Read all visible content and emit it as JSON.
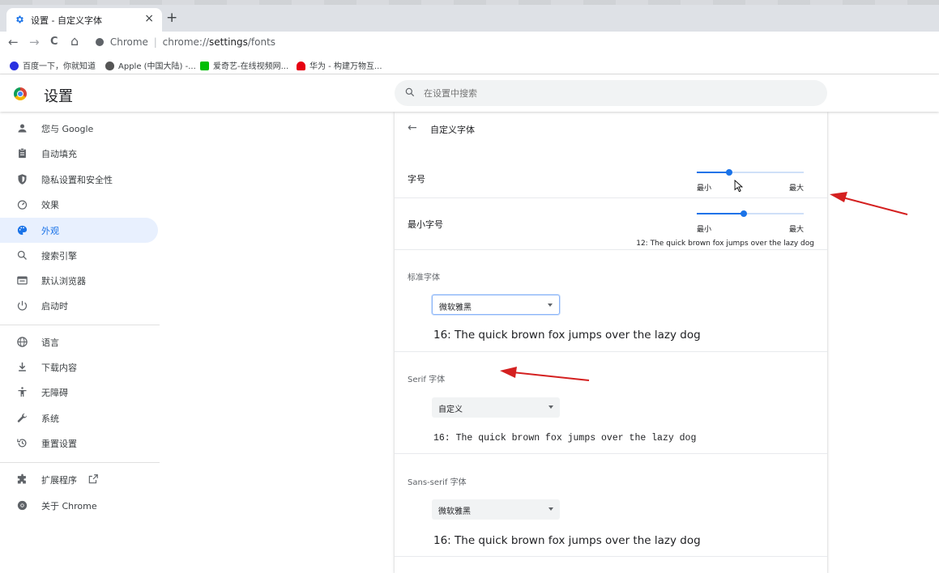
{
  "tab": {
    "title": "设置 - 自定义字体",
    "close_glyph": "×",
    "new_tab_glyph": "+"
  },
  "toolbar": {
    "back_glyph": "←",
    "forward_glyph": "→",
    "reload_glyph": "C",
    "home_glyph": "⌂",
    "site_label": "Chrome",
    "separator": "|",
    "url_scheme": "chrome://",
    "url_host": "settings",
    "url_path": "/fonts"
  },
  "bookmarks": [
    {
      "label": "百度一下，你就知道",
      "color": "#2932e1"
    },
    {
      "label": "Apple (中国大陆) -...",
      "color": "#555555"
    },
    {
      "label": "爱奇艺-在线视频网...",
      "color": "#00be06"
    },
    {
      "label": "华为 - 构建万物互...",
      "color": "#e60012"
    }
  ],
  "header": {
    "title": "设置",
    "search_placeholder": "在设置中搜索"
  },
  "sidebar": {
    "items": [
      {
        "label": "您与 Google",
        "icon": "person-icon",
        "active": false
      },
      {
        "label": "自动填充",
        "icon": "clipboard-icon",
        "active": false
      },
      {
        "label": "隐私设置和安全性",
        "icon": "shield-icon",
        "active": false
      },
      {
        "label": "效果",
        "icon": "speedometer-icon",
        "active": false
      },
      {
        "label": "外观",
        "icon": "palette-icon",
        "active": true
      },
      {
        "label": "搜索引擎",
        "icon": "search-icon",
        "active": false
      },
      {
        "label": "默认浏览器",
        "icon": "browser-window-icon",
        "active": false
      },
      {
        "label": "启动时",
        "icon": "power-icon",
        "active": false
      },
      {
        "label": "语言",
        "icon": "globe-icon",
        "active": false
      },
      {
        "label": "下载内容",
        "icon": "download-icon",
        "active": false
      },
      {
        "label": "无障碍",
        "icon": "accessibility-icon",
        "active": false
      },
      {
        "label": "系统",
        "icon": "wrench-icon",
        "active": false
      },
      {
        "label": "重置设置",
        "icon": "reset-icon",
        "active": false
      },
      {
        "label": "扩展程序",
        "icon": "puzzle-icon",
        "active": false
      },
      {
        "label": "关于 Chrome",
        "icon": "chrome-icon",
        "active": false
      }
    ]
  },
  "fonts_page": {
    "back_glyph": "←",
    "title": "自定义字体",
    "font_size": {
      "label": "字号",
      "min_label": "最小",
      "max_label": "最大",
      "value_fraction": 0.3
    },
    "min_font_size": {
      "label": "最小字号",
      "min_label": "最小",
      "max_label": "最大",
      "value_fraction": 0.44,
      "sample": "12: The quick brown fox jumps over the lazy dog"
    },
    "standard_font": {
      "label": "标准字体",
      "value": "微软雅黑",
      "sample": "16: The quick brown fox jumps over the lazy dog"
    },
    "serif_font": {
      "label": "Serif 字体",
      "value": "自定义",
      "sample": "16: The quick brown fox jumps over the lazy dog"
    },
    "sans_serif_font": {
      "label": "Sans-serif 字体",
      "value": "微软雅黑",
      "sample": "16: The quick brown fox jumps over the lazy dog"
    }
  },
  "colors": {
    "accent": "#1a73e8",
    "annotation_arrow": "#d42020"
  }
}
